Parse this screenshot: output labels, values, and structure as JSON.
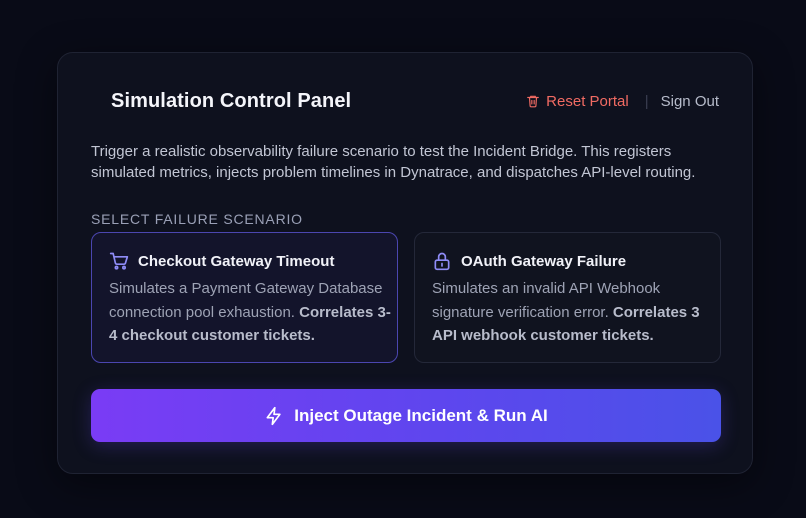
{
  "panel": {
    "title": "Simulation Control Panel",
    "reset_label": "Reset Portal",
    "separator": "|",
    "signout_label": "Sign Out",
    "description": "Trigger a realistic observability failure scenario to test the Incident Bridge. This registers simulated metrics, injects problem timelines in Dynatrace, and dispatches API-level routing.",
    "section_label": "SELECT FAILURE SCENARIO"
  },
  "scenarios": [
    {
      "icon": "shopping-cart-icon",
      "title": "Checkout Gateway Timeout",
      "desc_plain": "Simulates a Payment Gateway Database connection pool exhaustion. ",
      "desc_bold": "Correlates 3-4 checkout customer tickets.",
      "selected": true
    },
    {
      "icon": "lock-icon",
      "title": "OAuth Gateway Failure",
      "desc_plain": "Simulates an invalid API Webhook signature verification error. ",
      "desc_bold": "Correlates 3 API webhook customer tickets.",
      "selected": false
    }
  ],
  "inject_button": {
    "icon": "lightning-bolt-icon",
    "label": "Inject Outage Incident & Run AI"
  },
  "colors": {
    "background": "#090b17",
    "panel": "#0e111e",
    "accent": "#6c4cf1",
    "danger": "#f16b63"
  }
}
